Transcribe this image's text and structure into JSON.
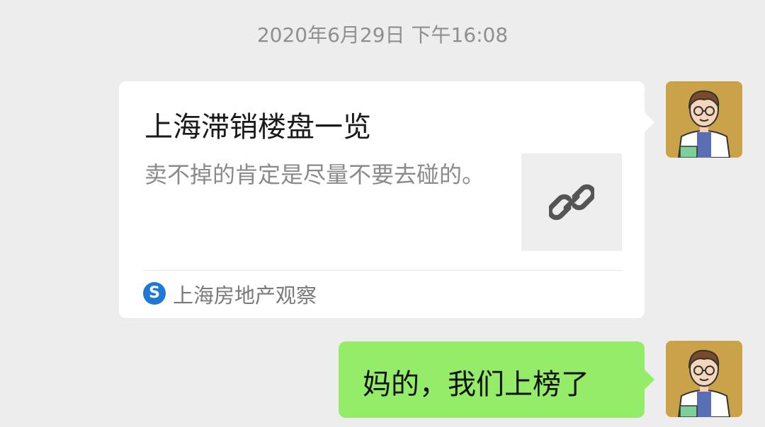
{
  "timestamp": "2020年6月29日 下午16:08",
  "link_card": {
    "title": "上海滞销楼盘一览",
    "description": "卖不掉的肯定是尽量不要去碰的。",
    "thumbnail_icon": "link-icon",
    "source_icon": "S",
    "source_name": "上海房地产观察"
  },
  "message": {
    "text": "妈的，我们上榜了"
  },
  "colors": {
    "background": "#ededed",
    "sent_bubble": "#95ec69",
    "card": "#ffffff",
    "source_icon": "#1f78d6"
  }
}
